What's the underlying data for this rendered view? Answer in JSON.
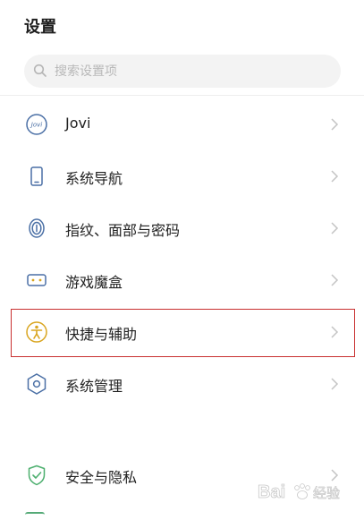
{
  "header": {
    "title": "设置"
  },
  "search": {
    "placeholder": "搜索设置项",
    "value": ""
  },
  "items": [
    {
      "label": "Jovi",
      "icon": "jovi-icon"
    },
    {
      "label": "系统导航",
      "icon": "phone-icon"
    },
    {
      "label": "指纹、面部与密码",
      "icon": "fingerprint-icon"
    },
    {
      "label": "游戏魔盒",
      "icon": "gamepad-icon"
    },
    {
      "label": "快捷与辅助",
      "icon": "accessibility-icon",
      "highlighted": true
    },
    {
      "label": "系统管理",
      "icon": "hexagon-settings-icon"
    },
    {
      "label": "安全与隐私",
      "icon": "shield-check-icon"
    }
  ],
  "watermark": {
    "logo_text": "Bai",
    "logo_suffix": "经验"
  },
  "colors": {
    "icon": "#4a6fa5",
    "accent_gold": "#d9a520",
    "shield_green": "#4caf6e",
    "highlight_border": "#c83030",
    "chevron": "#c4c4c4"
  }
}
